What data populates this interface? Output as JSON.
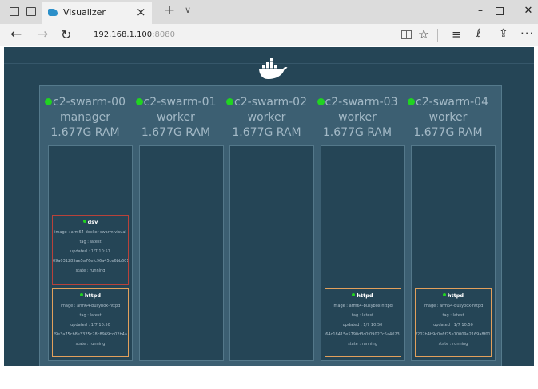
{
  "browser": {
    "tab_title": "Visualizer",
    "tab_close": "×",
    "new_tab": "+",
    "tab_list": "∨",
    "url_host": "192.168.1.100",
    "url_port": ":8080",
    "window": {
      "minimize": "–",
      "close": "✕"
    },
    "nav": {
      "back": "←",
      "forward": "→",
      "refresh": "↻",
      "favorite": "☆",
      "hub": "≡",
      "notes": "ℓ",
      "share": "⇪",
      "more": "···"
    }
  },
  "nodes": [
    {
      "name": "c2-swarm-00",
      "role": "manager",
      "ram": "1.677G RAM",
      "containers": [
        {
          "kind": "dsv",
          "name": "dsv",
          "image": "image : arm64-docker-swarm-visual",
          "tag": "tag : latest",
          "updated": "updated : 1/7 10:51",
          "id": "09a031285ae5a76efc96a45ce6bb601",
          "state": "state : running"
        },
        {
          "kind": "httpd",
          "name": "httpd",
          "image": "image : arm64-busybox-httpd",
          "tag": "tag : latest",
          "updated": "updated : 1/7 10:50",
          "id": "f9e3a75cb8e3325c28c8969cd02b4a",
          "state": "state : running"
        }
      ]
    },
    {
      "name": "c2-swarm-01",
      "role": "worker",
      "ram": "1.677G RAM",
      "containers": []
    },
    {
      "name": "c2-swarm-02",
      "role": "worker",
      "ram": "1.677G RAM",
      "containers": []
    },
    {
      "name": "c2-swarm-03",
      "role": "worker",
      "ram": "1.677G RAM",
      "containers": [
        {
          "kind": "httpd",
          "name": "httpd",
          "image": "image : arm64-busybox-httpd",
          "tag": "tag : latest",
          "updated": "updated : 1/7 10:50",
          "id": "64c18415e5790d3c0f09027c5a4023",
          "state": "state : running"
        }
      ]
    },
    {
      "name": "c2-swarm-04",
      "role": "worker",
      "ram": "1.677G RAM",
      "containers": [
        {
          "kind": "httpd",
          "name": "httpd",
          "image": "image : arm64-busybox-httpd",
          "tag": "tag : latest",
          "updated": "updated : 1/7 10:50",
          "id": "f202b4b9c0e6f75e10009e2169a8f01",
          "state": "state : running"
        }
      ]
    }
  ],
  "colors": {
    "page_bg": "#254556",
    "swarm_bg": "#3c5f72",
    "status_green": "#21d321",
    "dsv_border": "#b9423a",
    "httpd_border": "#e2a05c",
    "docker_logo": "#ffffff"
  }
}
